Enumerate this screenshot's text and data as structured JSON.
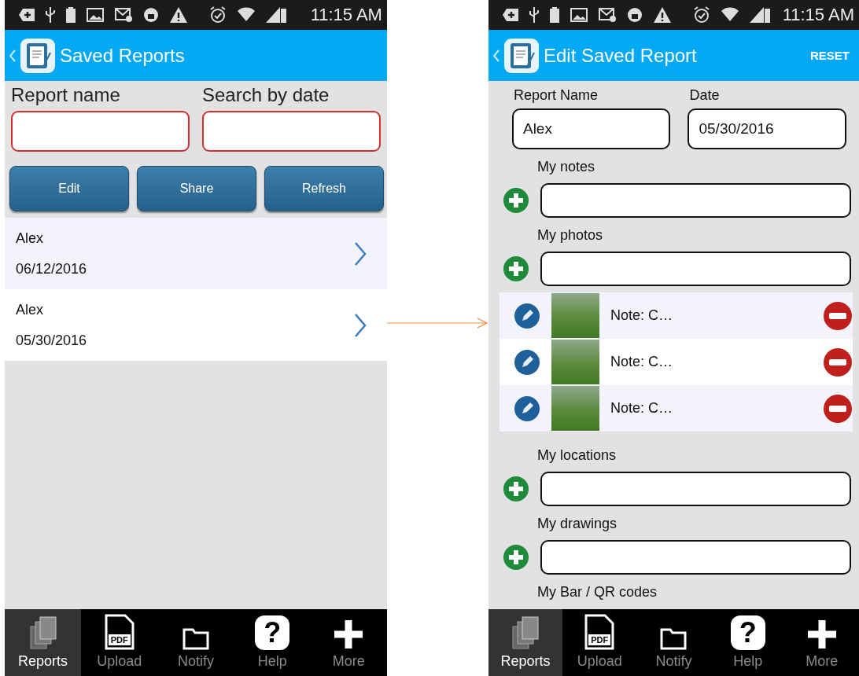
{
  "left": {
    "status_time": "11:15 AM",
    "header": {
      "title": "Saved Reports"
    },
    "search_fields": [
      {
        "label": "Report name"
      },
      {
        "label": "Search by date"
      }
    ],
    "buttons": [
      "Edit",
      "Share",
      "Refresh"
    ],
    "reports": [
      {
        "name": "Alex",
        "date": "06/12/2016"
      },
      {
        "name": "Alex",
        "date": "05/30/2016"
      }
    ],
    "nav": [
      {
        "kind": "reports",
        "label": "Reports",
        "selected": true
      },
      {
        "kind": "pdf",
        "label": "Upload",
        "icon_text": "PDF",
        "selected": false
      },
      {
        "kind": "folder",
        "label": "Notify",
        "selected": false
      },
      {
        "kind": "help",
        "label": "Help",
        "icon_text": "?",
        "selected": false
      },
      {
        "kind": "plus",
        "label": "More",
        "selected": false
      }
    ]
  },
  "right": {
    "status_time": "11:15 AM",
    "header": {
      "title": "Edit Saved Report",
      "action": "RESET"
    },
    "fields": [
      {
        "label": "Report Name",
        "value": "Alex"
      },
      {
        "label": "Date",
        "value": "05/30/2016"
      }
    ],
    "sections": [
      {
        "label": "My notes",
        "kind": "field"
      },
      {
        "label": "My photos",
        "kind": "field",
        "photos": [
          {
            "note": "Note:  C…"
          },
          {
            "note": "Note:  C…"
          },
          {
            "note": "Note:  C…"
          }
        ]
      },
      {
        "label": "My locations",
        "kind": "field"
      },
      {
        "label": "My drawings",
        "kind": "field"
      },
      {
        "label": "My Bar / QR codes",
        "kind": "heading"
      }
    ],
    "nav": [
      {
        "kind": "reports",
        "label": "Reports",
        "selected": true
      },
      {
        "kind": "pdf",
        "label": "Upload",
        "icon_text": "PDF",
        "selected": false
      },
      {
        "kind": "folder",
        "label": "Notify",
        "selected": false
      },
      {
        "kind": "help",
        "label": "Help",
        "icon_text": "?",
        "selected": false
      },
      {
        "kind": "plus",
        "label": "More",
        "selected": false
      }
    ]
  }
}
